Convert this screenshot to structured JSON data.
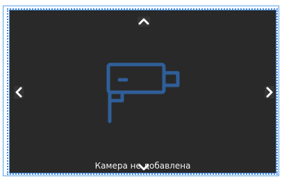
{
  "camera_view": {
    "status_text": "Камера не добавлена"
  },
  "icons": {
    "nav_up": "chevron-up-icon",
    "nav_down": "chevron-down-icon",
    "nav_left": "chevron-left-icon",
    "nav_right": "chevron-right-icon",
    "placeholder": "security-camera-icon"
  },
  "colors": {
    "background": "#292929",
    "icon": "#2f5f99",
    "border": "#3f86d8",
    "nav_arrow": "#ffffff",
    "text": "#f2f2f2"
  }
}
